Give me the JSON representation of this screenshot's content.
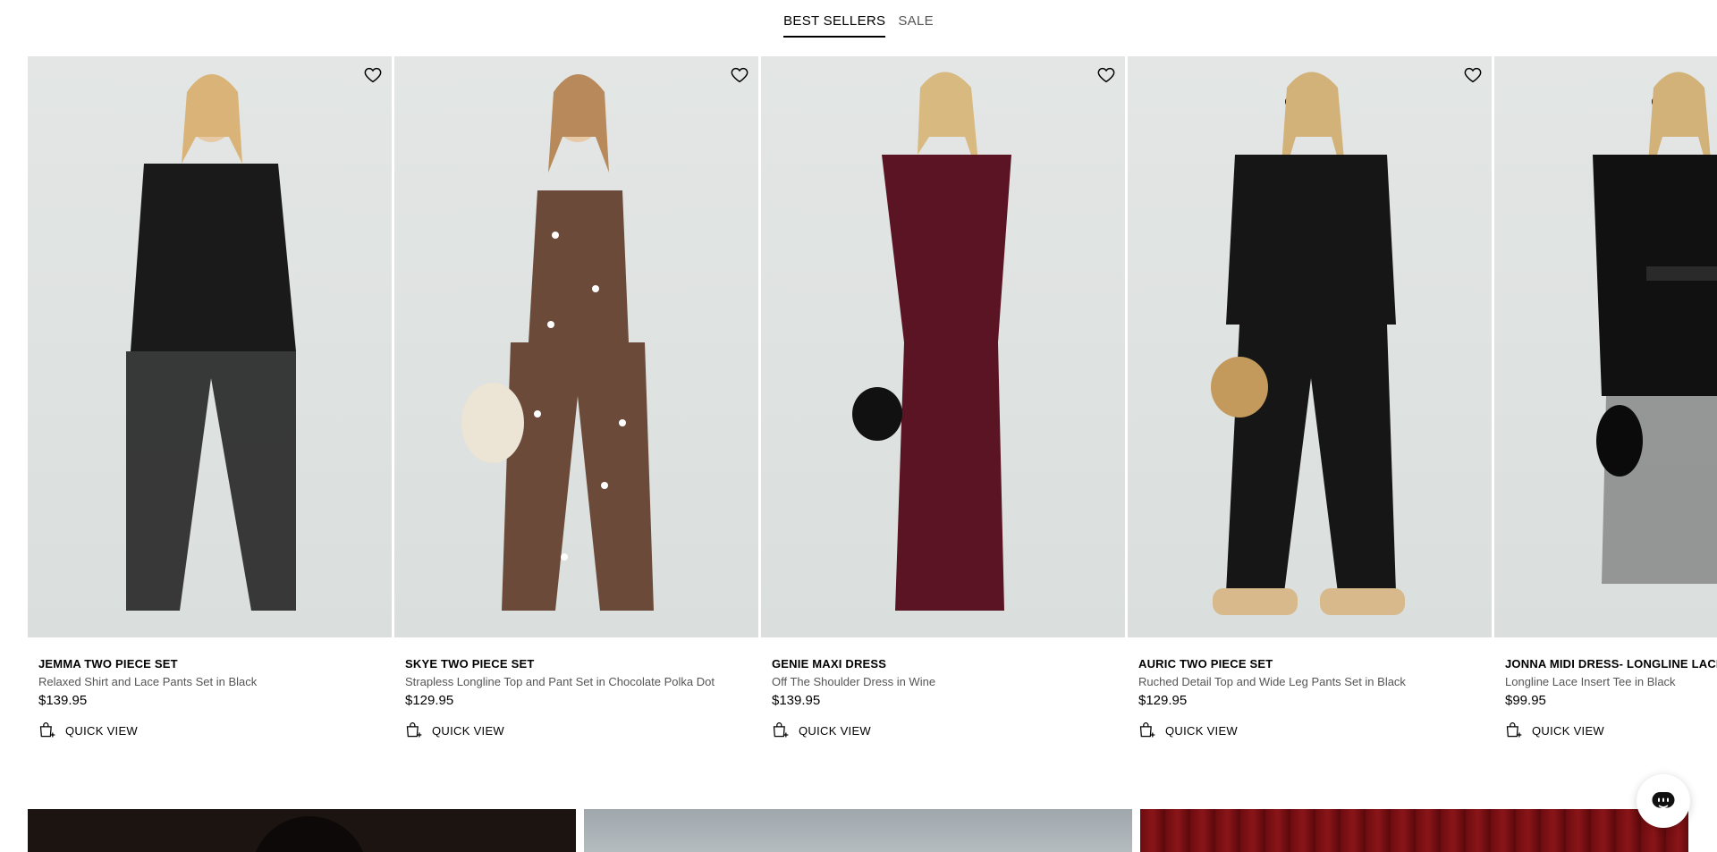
{
  "tabs": [
    {
      "label": "BEST SELLERS",
      "active": true
    },
    {
      "label": "SALE",
      "active": false
    }
  ],
  "products": [
    {
      "name": "JEMMA TWO PIECE SET",
      "description": "Relaxed Shirt and Lace Pants Set in Black",
      "price": "$139.95",
      "quick_view": "QUICK VIEW",
      "color": "#1a1a1a"
    },
    {
      "name": "SKYE TWO PIECE SET",
      "description": "Strapless Longline Top and Pant Set in Chocolate Polka Dot",
      "price": "$129.95",
      "quick_view": "QUICK VIEW",
      "color": "#6b4a3a"
    },
    {
      "name": "GENIE MAXI DRESS",
      "description": "Off The Shoulder Dress in Wine",
      "price": "$139.95",
      "quick_view": "QUICK VIEW",
      "color": "#5a1424"
    },
    {
      "name": "AURIC TWO PIECE SET",
      "description": "Ruched Detail Top and Wide Leg Pants Set in Black",
      "price": "$129.95",
      "quick_view": "QUICK VIEW",
      "color": "#161616"
    },
    {
      "name": "JONNA MIDI DRESS- LONGLINE LACE BLACK",
      "description": "Longline Lace Insert Tee in Black",
      "price": "$99.95",
      "quick_view": "QUICK VIEW",
      "color": "#111111"
    }
  ],
  "icons": {
    "wishlist": "heart-icon",
    "quick_view": "bag-plus-icon",
    "chat": "chat-icon"
  }
}
